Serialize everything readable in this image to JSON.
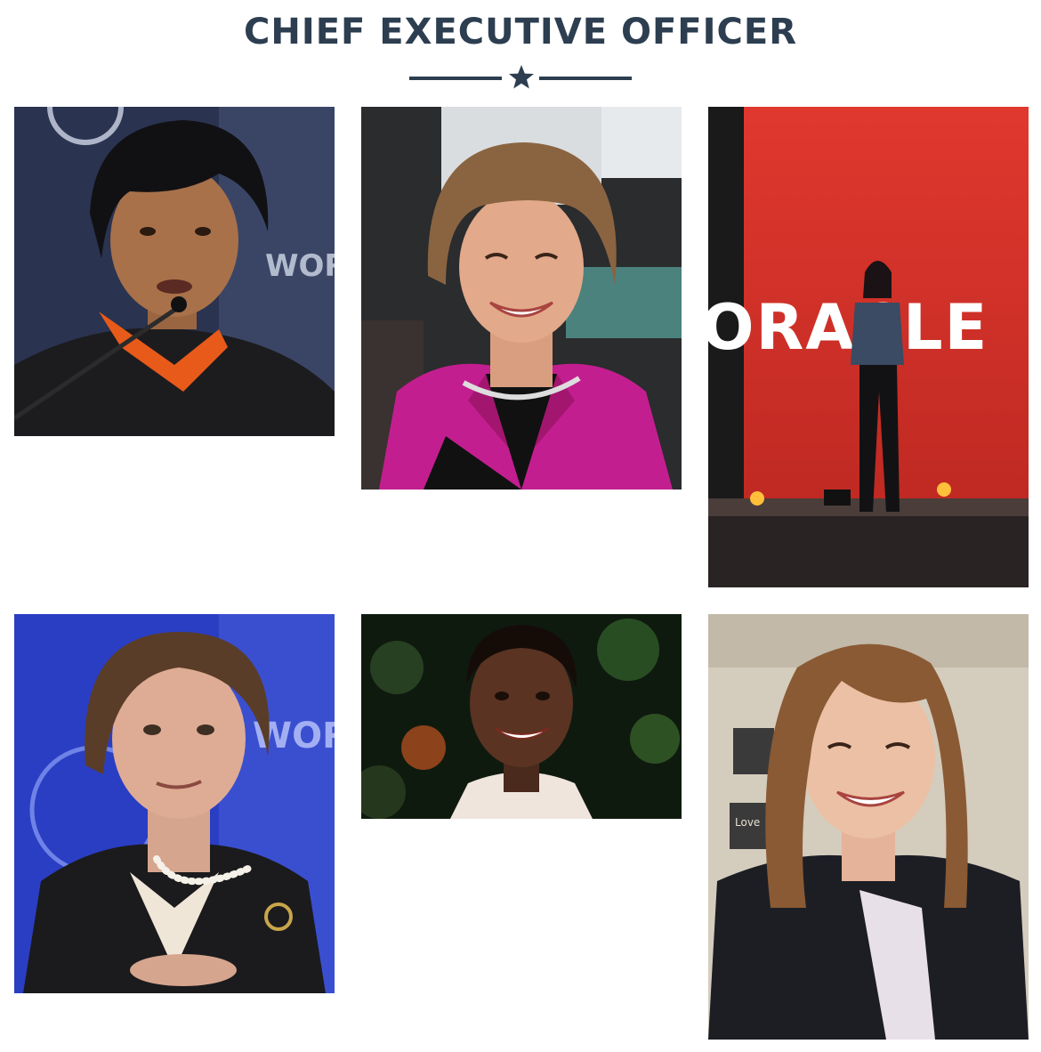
{
  "header": {
    "title": "CHIEF EXECUTIVE OFFICER",
    "divider_icon": "star-icon"
  },
  "colors": {
    "heading": "#2c3e50",
    "oracle_red": "#d8322b"
  },
  "gallery": {
    "photos": [
      {
        "backdrop_text": "WORLD ECONOMIC FORUM"
      },
      {
        "backdrop_text": ""
      },
      {
        "backdrop_text": "ORACLE"
      },
      {
        "backdrop_text": "WORLD ECONOMIC FORUM"
      },
      {
        "backdrop_text": ""
      },
      {
        "backdrop_text": "Love"
      }
    ]
  }
}
